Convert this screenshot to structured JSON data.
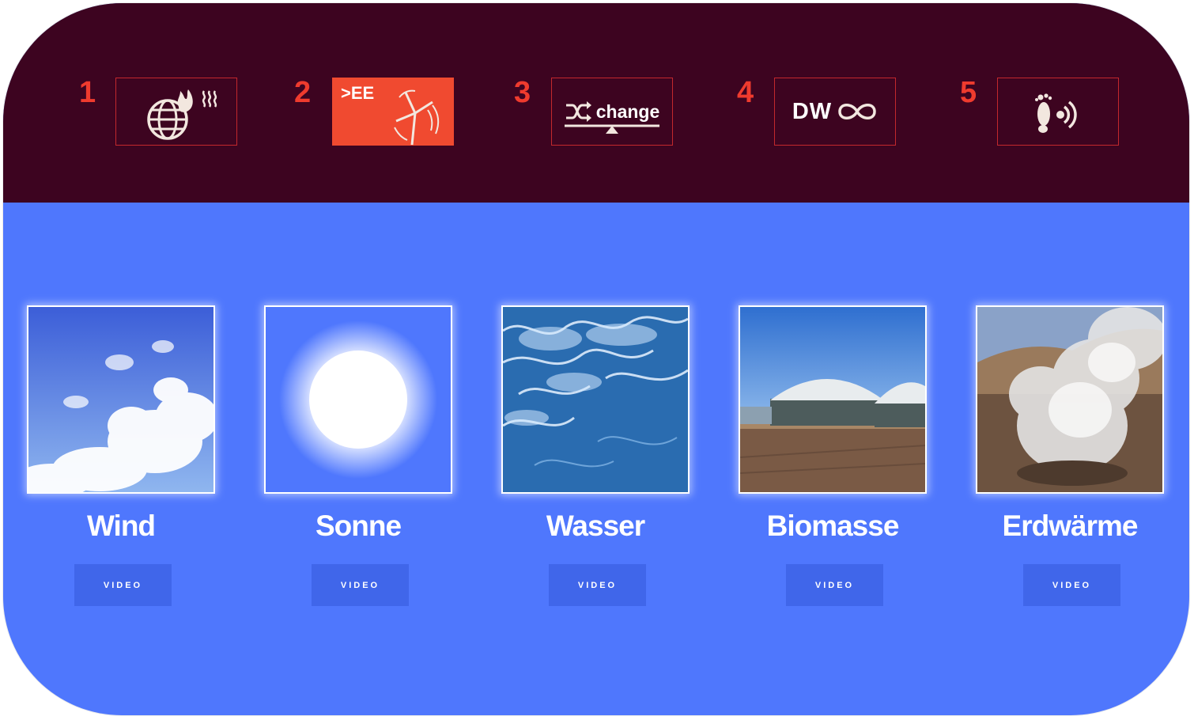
{
  "steps": [
    {
      "number": "1",
      "icon": "globe-fire-heat-icon"
    },
    {
      "number": "2",
      "icon": "wind-turbine-icon",
      "label": ">EE",
      "active": true
    },
    {
      "number": "3",
      "icon": "shuffle-balance-icon",
      "label": "change"
    },
    {
      "number": "4",
      "icon": "infinity-icon",
      "label": "DW"
    },
    {
      "number": "5",
      "icon": "footprint-icon"
    }
  ],
  "energy_sources": [
    {
      "title": "Wind",
      "button": "VIDEO",
      "image": "sky-clouds"
    },
    {
      "title": "Sonne",
      "button": "VIDEO",
      "image": "sun"
    },
    {
      "title": "Wasser",
      "button": "VIDEO",
      "image": "ocean-waves"
    },
    {
      "title": "Biomasse",
      "button": "VIDEO",
      "image": "biogas-plant"
    },
    {
      "title": "Erdwärme",
      "button": "VIDEO",
      "image": "geothermal-steam"
    }
  ],
  "colors": {
    "header_bg": "#3d0420",
    "main_bg": "#4f77fd",
    "accent": "#ef3b2e",
    "button_bg": "#4066ea"
  }
}
